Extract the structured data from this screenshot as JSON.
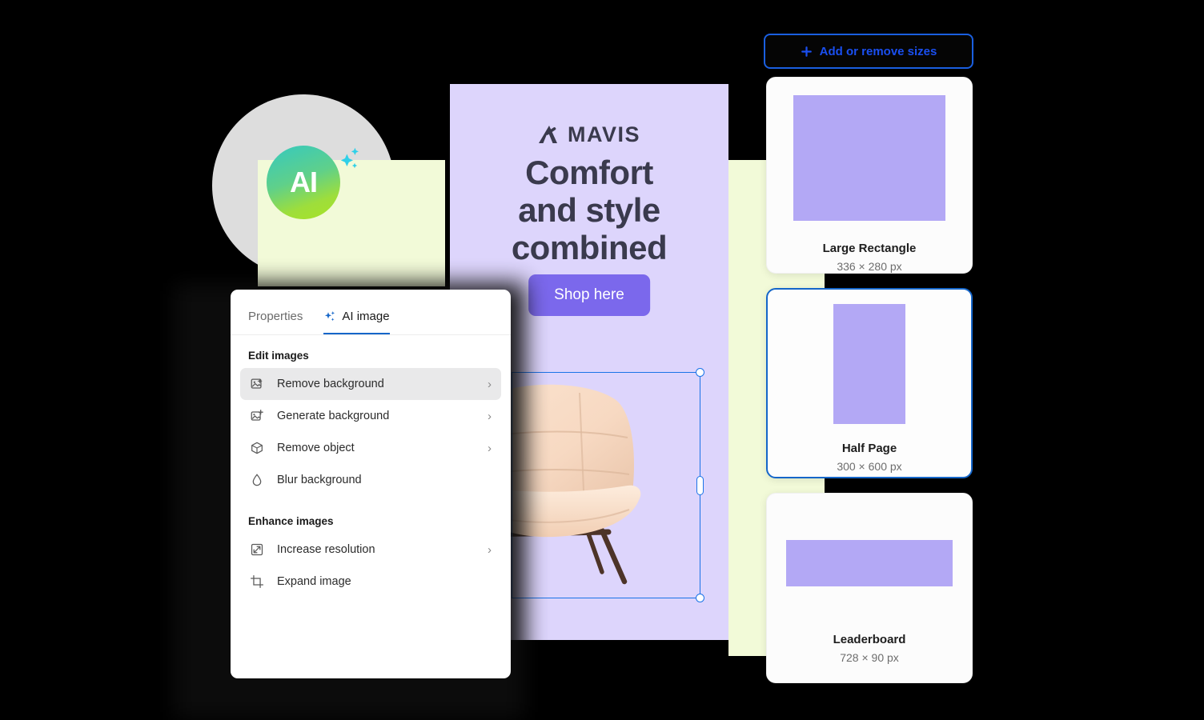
{
  "decor": {
    "ai_badge_label": "AI",
    "ai_badge_icon": "ai-sparkle-badge"
  },
  "banner": {
    "brand": "MAVIS",
    "headline_lines": [
      "Comfort",
      "and style",
      "combined"
    ],
    "cta_label": "Shop here",
    "background_color": "#ddd5fc",
    "cta_color": "#7b68ec",
    "artwork": "armchair-photo"
  },
  "panel": {
    "tabs": [
      {
        "label": "Properties",
        "active": false,
        "icon": ""
      },
      {
        "label": "AI image",
        "active": true,
        "icon": "sparkle-icon"
      }
    ],
    "sections": [
      {
        "title": "Edit images",
        "items": [
          {
            "label": "Remove background",
            "icon": "image-erase-icon",
            "chevron": true,
            "highlighted": true
          },
          {
            "label": "Generate background",
            "icon": "image-plus-icon",
            "chevron": true,
            "highlighted": false
          },
          {
            "label": "Remove object",
            "icon": "cube-icon",
            "chevron": true,
            "highlighted": false
          },
          {
            "label": "Blur background",
            "icon": "droplet-icon",
            "chevron": false,
            "highlighted": false
          }
        ]
      },
      {
        "title": "Enhance images",
        "items": [
          {
            "label": "Increase resolution",
            "icon": "expand-arrows-icon",
            "chevron": true,
            "highlighted": false
          },
          {
            "label": "Expand image",
            "icon": "crop-icon",
            "chevron": false,
            "highlighted": false
          }
        ]
      }
    ],
    "accent_color": "#1566c9"
  },
  "sizes_panel": {
    "add_button_label": "Add or remove sizes",
    "add_button_icon": "plus-icon",
    "cards": [
      {
        "name": "Large Rectangle",
        "dimensions": "336 × 280 px",
        "selected": false,
        "thumb_w": 190,
        "thumb_h": 158
      },
      {
        "name": "Half Page",
        "dimensions": "300 × 600 px",
        "selected": true,
        "thumb_w": 90,
        "thumb_h": 150
      },
      {
        "name": "Leaderboard",
        "dimensions": "728 × 90 px",
        "selected": false,
        "thumb_w": 208,
        "thumb_h": 58
      }
    ],
    "placeholder_color": "#b3a8f5",
    "selected_border_color": "#1566c9"
  },
  "canvas": {
    "selection_label": "image-selection-frame"
  }
}
